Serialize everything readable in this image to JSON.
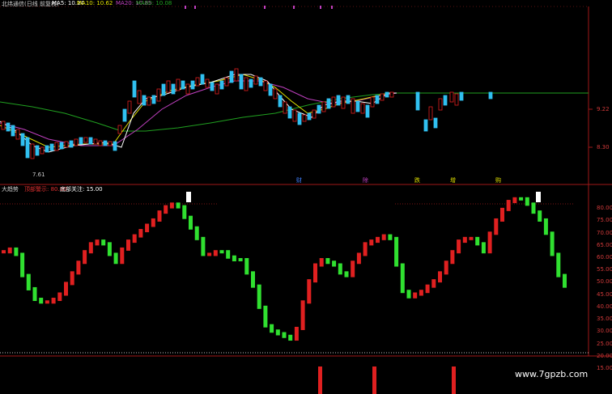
{
  "header": {
    "title": "北纬通信(日线 前复权)",
    "ma5_label": "MA5: 10.24",
    "ma10_label": "MA10: 10.62",
    "ma20_label": "MA20: 10.85",
    "ma60_label": "MA60: 10.08"
  },
  "price_panel": {
    "y_ticks": [
      "9.22",
      "8.30"
    ],
    "low_marker": "7.61",
    "event_markers": [
      "财",
      "除",
      "跌",
      "增",
      "购"
    ]
  },
  "indicator_panel": {
    "name": "大趋势",
    "param1": "顶部警示: 80.00",
    "param2": "底部关注: 15.00",
    "y_ticks": [
      "80.00",
      "75.00",
      "70.00",
      "65.00",
      "60.00",
      "55.00",
      "50.00",
      "45.00",
      "40.00",
      "35.00",
      "30.00",
      "25.00",
      "20.00",
      "15.00"
    ]
  },
  "watermark": "www.7gpzb.com",
  "colors": {
    "up": "#e02020",
    "down": "#30e030",
    "ma5": "#ffffff",
    "ma10": "#e0e000",
    "ma20": "#c040c0",
    "ma60": "#20a020",
    "frame": "#a01818"
  },
  "chart_data": {
    "type": "line",
    "indicator": {
      "values": [
        59,
        60,
        58,
        50,
        45,
        41,
        40,
        40,
        41,
        43,
        47,
        51,
        55,
        59,
        62,
        63,
        62,
        58,
        55,
        60,
        63,
        65,
        67,
        69,
        71,
        74,
        76,
        77,
        76,
        72,
        68,
        64,
        58,
        58,
        59,
        59,
        57,
        56,
        56,
        51,
        46,
        38,
        31,
        29,
        28,
        27,
        26,
        30,
        40,
        48,
        54,
        56,
        55,
        54,
        51,
        50,
        55,
        58,
        62,
        63,
        64,
        65,
        64,
        54,
        44,
        42,
        43,
        44,
        46,
        48,
        51,
        55,
        59,
        63,
        64,
        64,
        62,
        59,
        66,
        71,
        75,
        78,
        79,
        79,
        77,
        74,
        71,
        66,
        58,
        50,
        46
      ],
      "direction": [
        "u",
        "u",
        "d",
        "d",
        "d",
        "d",
        "d",
        "u",
        "u",
        "u",
        "u",
        "u",
        "u",
        "u",
        "u",
        "u",
        "d",
        "d",
        "d",
        "u",
        "u",
        "u",
        "u",
        "u",
        "u",
        "u",
        "u",
        "u",
        "d",
        "d",
        "d",
        "d",
        "d",
        "u",
        "u",
        "d",
        "d",
        "d",
        "d",
        "d",
        "d",
        "d",
        "d",
        "d",
        "d",
        "d",
        "d",
        "u",
        "u",
        "u",
        "u",
        "u",
        "d",
        "d",
        "d",
        "d",
        "u",
        "u",
        "u",
        "u",
        "u",
        "u",
        "d",
        "d",
        "d",
        "d",
        "u",
        "u",
        "u",
        "u",
        "u",
        "u",
        "u",
        "u",
        "u",
        "u",
        "d",
        "d",
        "u",
        "u",
        "u",
        "u",
        "u",
        "d",
        "d",
        "d",
        "d",
        "d",
        "d",
        "d",
        "d"
      ],
      "ylim": [
        15,
        82
      ],
      "top_warning": 80,
      "bottom_watch": 15
    }
  }
}
